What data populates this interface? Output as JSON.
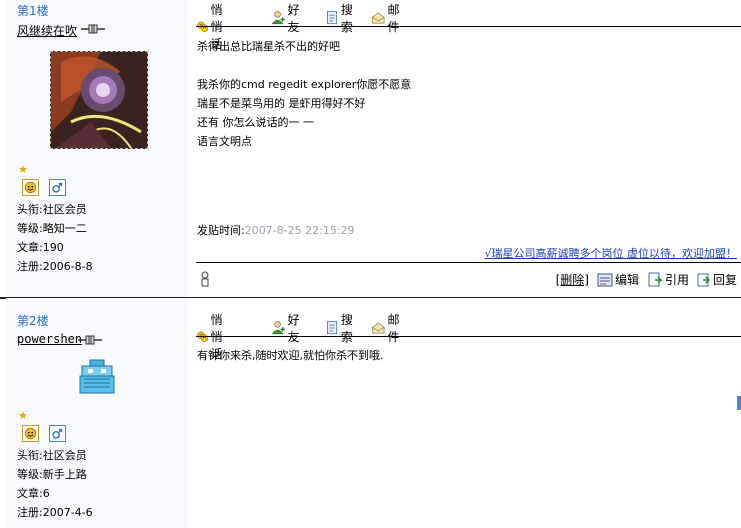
{
  "toolbar": {
    "whisper": "悄悄话",
    "friend": "好友",
    "search": "搜索",
    "mail": "邮件"
  },
  "labels": {
    "title_prefix": "头衔:",
    "level_prefix": "等级:",
    "posts_prefix": "文章:",
    "register_prefix": "注册:"
  },
  "posts": [
    {
      "floor": "第1楼",
      "username": "风继续在吹",
      "title": "社区会员",
      "level": "略知一二",
      "article_count": "190",
      "register_date": "2006-8-8",
      "content": "杀得出总比瑞星杀不出的好吧\n\n我杀你的cmd regedit explorer你愿不愿意\n瑞星不是菜鸟用的 是虾用得好不好\n还有 你怎么说话的一 一\n语言文明点",
      "post_time_label": "发贴时间:",
      "post_time": "2007-8-25 22:15:29",
      "ad_link": "√瑞星公司高薪诚聘多个岗位 虚位以待，欢迎加盟！",
      "actions": {
        "delete": "[删除]",
        "edit": "编辑",
        "quote": "引用",
        "reply": "回复"
      }
    },
    {
      "floor": "第2楼",
      "username": "powershen",
      "title": "社区会员",
      "level": "新手上路",
      "article_count": "6",
      "register_date": "2007-4-6",
      "content": "有钟你来杀,随时欢迎,就怕你杀不到哦."
    }
  ],
  "icons": [
    "online-status-icon",
    "star-icon",
    "face-icon",
    "male-icon",
    "whisper-icon",
    "friend-icon",
    "search-icon",
    "mail-icon",
    "ip-icon",
    "edit-icon",
    "quote-icon",
    "reply-icon"
  ]
}
